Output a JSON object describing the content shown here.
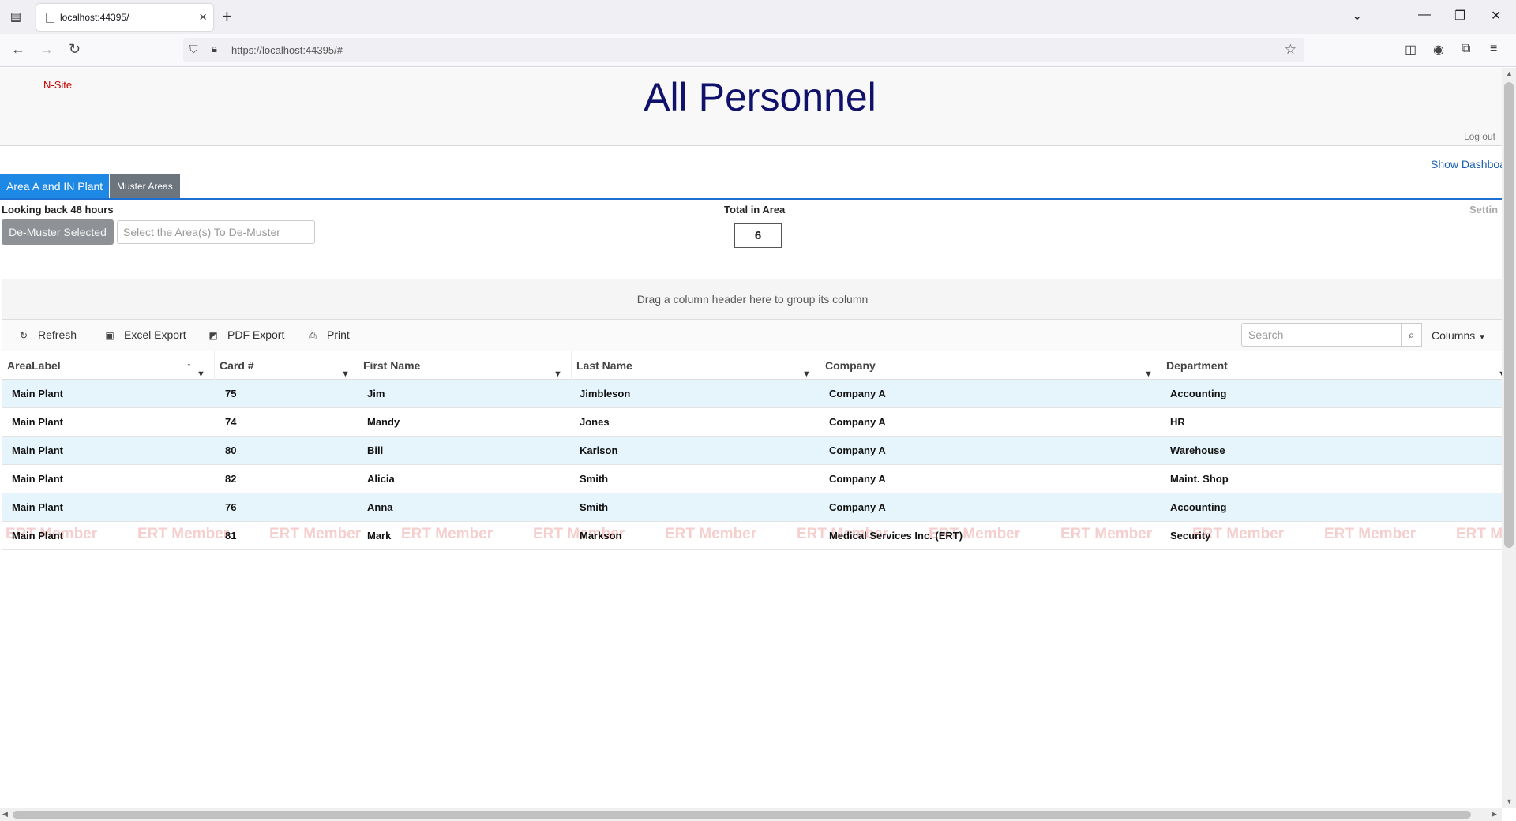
{
  "browser": {
    "tab_title": "localhost:44395/",
    "url": "https://localhost:44395/#"
  },
  "header": {
    "brand": "N-Site",
    "title": "All Personnel",
    "logout": "Log out"
  },
  "show_dashboard": "Show Dashboa",
  "tabs": [
    {
      "label": "Area A and IN Plant",
      "active": true
    },
    {
      "label": "Muster Areas",
      "active": false
    }
  ],
  "controls": {
    "lookback": "Looking back 48 hours",
    "demuster_button": "De-Muster Selected",
    "area_select_placeholder": "Select the Area(s) To De-Muster",
    "total_label": "Total in Area",
    "total_value": "6",
    "settings": "Settin"
  },
  "grid": {
    "group_panel": "Drag a column header here to group its column",
    "toolbar": {
      "refresh": "Refresh",
      "excel": "Excel Export",
      "pdf": "PDF Export",
      "print": "Print",
      "search_placeholder": "Search",
      "columns": "Columns"
    },
    "columns": [
      "AreaLabel",
      "Card #",
      "First Name",
      "Last Name",
      "Company",
      "Department"
    ],
    "rows": [
      [
        "Main Plant",
        "75",
        "Jim",
        "Jimbleson",
        "Company A",
        "Accounting"
      ],
      [
        "Main Plant",
        "74",
        "Mandy",
        "Jones",
        "Company A",
        "HR"
      ],
      [
        "Main Plant",
        "80",
        "Bill",
        "Karlson",
        "Company A",
        "Warehouse"
      ],
      [
        "Main Plant",
        "82",
        "Alicia",
        "Smith",
        "Company A",
        "Maint. Shop"
      ],
      [
        "Main Plant",
        "76",
        "Anna",
        "Smith",
        "Company A",
        "Accounting"
      ],
      [
        "Main Plant",
        "81",
        "Mark",
        "Markson",
        "Medical Services Inc. (ERT)",
        "Security"
      ]
    ],
    "watermark": "ERT Member"
  }
}
